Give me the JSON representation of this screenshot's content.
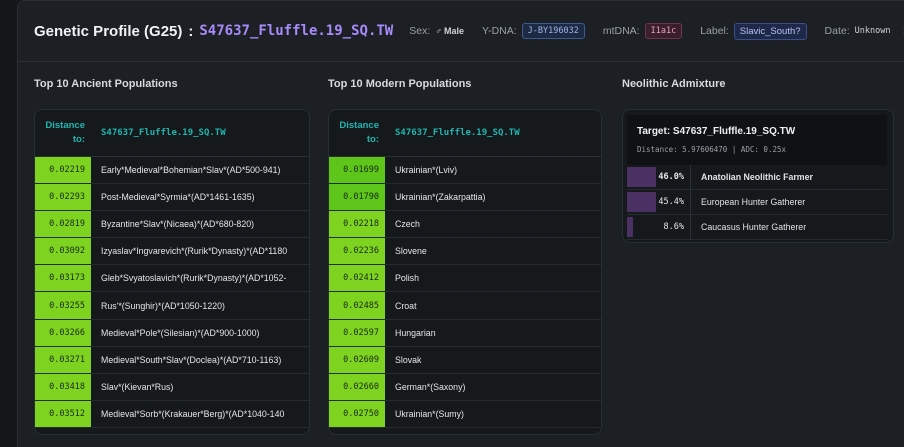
{
  "header": {
    "title": "Genetic Profile (G25)",
    "colon": ":",
    "sample_name": "S47637_Fluffle.19_SQ.TW",
    "sex_label": "Sex:",
    "sex_icon": "♂",
    "sex_value": "Male",
    "ydna_label": "Y-DNA:",
    "ydna_value": "J-BY196032",
    "mtdna_label": "mtDNA:",
    "mtdna_value": "I1a1c",
    "label_label": "Label:",
    "label_value": "Slavic_South?",
    "date_label": "Date:",
    "date_value": "Unknown",
    "close_icon": "×"
  },
  "ancient": {
    "title": "Top 10 Ancient Populations",
    "head_dist": "Distance to:",
    "head_name": "S47637_Fluffle.19_SQ.TW",
    "rows": [
      {
        "dist": "0.02219",
        "name": "Early*Medieval*Bohemian*Slav*(AD*500-941)"
      },
      {
        "dist": "0.02293",
        "name": "Post-Medieval*Syrmia*(AD*1461-1635)"
      },
      {
        "dist": "0.02819",
        "name": "Byzantine*Slav*(Nicaea)*(AD*680-820)"
      },
      {
        "dist": "0.03092",
        "name": "Izyaslav*Ingvarevich*(Rurik*Dynasty)*(AD*1180"
      },
      {
        "dist": "0.03173",
        "name": "Gleb*Svyatoslavich*(Rurik*Dynasty)*(AD*1052-"
      },
      {
        "dist": "0.03255",
        "name": "Rus'*(Sunghir)*(AD*1050-1220)"
      },
      {
        "dist": "0.03266",
        "name": "Medieval*Pole*(Silesian)*(AD*900-1000)"
      },
      {
        "dist": "0.03271",
        "name": "Medieval*South*Slav*(Doclea)*(AD*710-1163)"
      },
      {
        "dist": "0.03418",
        "name": "Slav*(Kievan*Rus)"
      },
      {
        "dist": "0.03512",
        "name": "Medieval*Sorb*(Krakauer*Berg)*(AD*1040-140"
      }
    ]
  },
  "modern": {
    "title": "Top 10 Modern Populations",
    "head_dist": "Distance to:",
    "head_name": "S47637_Fluffle.19_SQ.TW",
    "rows": [
      {
        "dist": "0.01699",
        "name": "Ukrainian*(Lviv)"
      },
      {
        "dist": "0.01790",
        "name": "Ukrainian*(Zakarpattia)"
      },
      {
        "dist": "0.02218",
        "name": "Czech"
      },
      {
        "dist": "0.02236",
        "name": "Slovene"
      },
      {
        "dist": "0.02412",
        "name": "Polish"
      },
      {
        "dist": "0.02485",
        "name": "Croat"
      },
      {
        "dist": "0.02597",
        "name": "Hungarian"
      },
      {
        "dist": "0.02609",
        "name": "Slovak"
      },
      {
        "dist": "0.02660",
        "name": "German*(Saxony)"
      },
      {
        "dist": "0.02750",
        "name": "Ukrainian*(Sumy)"
      }
    ]
  },
  "neolithic": {
    "title": "Neolithic Admixture",
    "target": "Target: S47637_Fluffle.19_SQ.TW",
    "sub": "Distance: 5.97606470  |  ADC: 0.25x",
    "rows": [
      {
        "pct": "46.0%",
        "value": 46.0,
        "name": "Anatolian Neolithic Farmer",
        "bold": true
      },
      {
        "pct": "45.4%",
        "value": 45.4,
        "name": "European Hunter Gatherer",
        "bold": false
      },
      {
        "pct": "8.6%",
        "value": 8.6,
        "name": "Caucasus Hunter Gatherer",
        "bold": false
      }
    ]
  },
  "colors": {
    "accent_purple": "#a78bfa",
    "accent_teal": "#1fb5b0",
    "dist_green": "#7ed321",
    "dist_green_dark": "#5ec51a",
    "bar_purple": "#4b3163"
  }
}
